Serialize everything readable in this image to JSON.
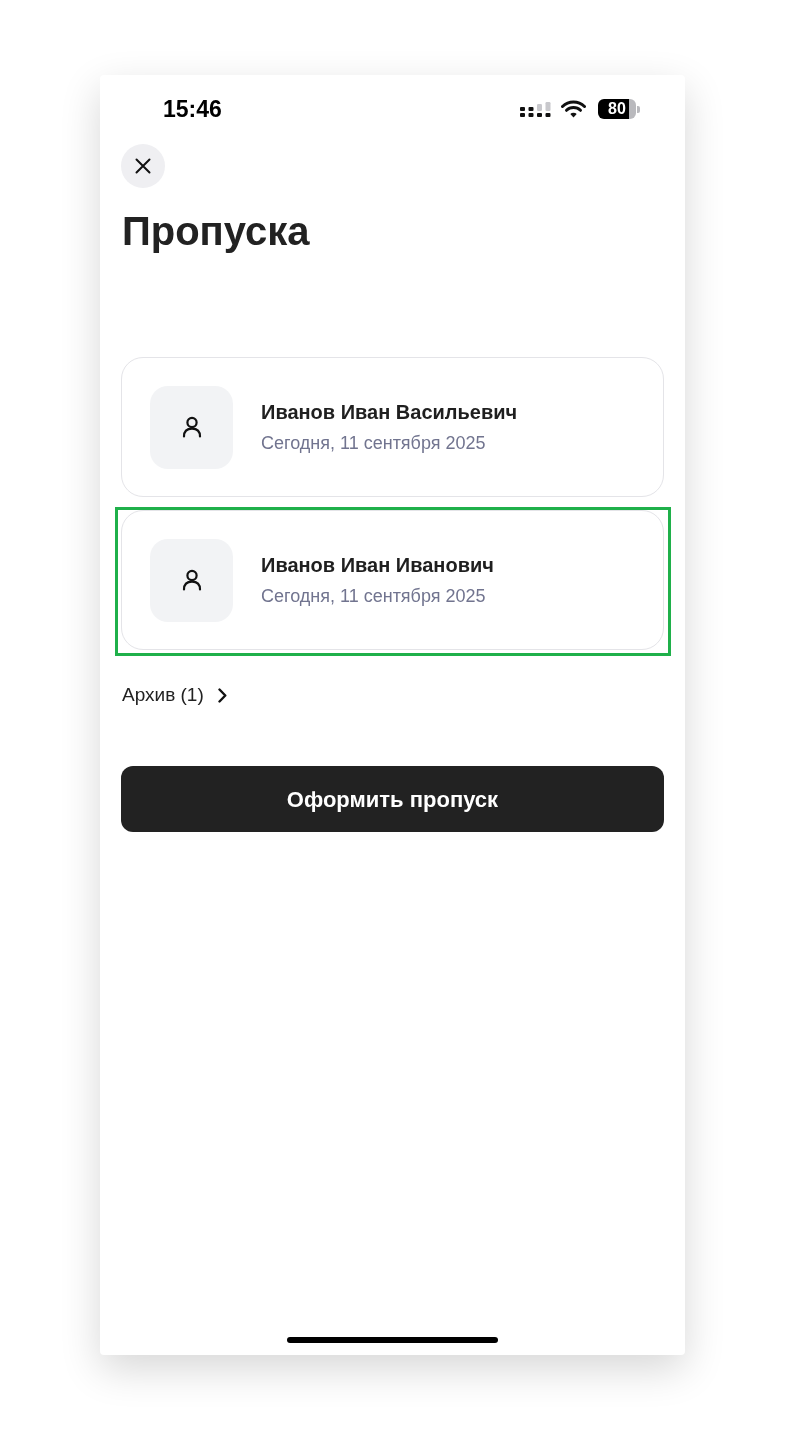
{
  "status_bar": {
    "time": "15:46",
    "battery_text": "80"
  },
  "header": {
    "title": "Пропуска"
  },
  "passes": [
    {
      "name": "Иванов Иван Васильевич",
      "date": "Сегодня, 11 сентября 2025",
      "selected": false
    },
    {
      "name": "Иванов Иван Иванович",
      "date": "Сегодня, 11 сентября 2025",
      "selected": true
    }
  ],
  "archive_link": "Архив (1)",
  "primary_button": "Оформить пропуск"
}
